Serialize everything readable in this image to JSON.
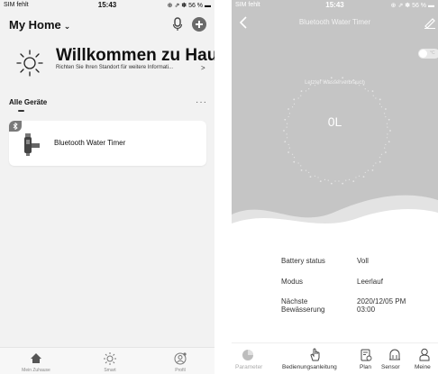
{
  "left_screen": {
    "status": {
      "carrier": "SIM fehlt",
      "time": "15:43",
      "battery": "56 %"
    },
    "home_title": "My Home",
    "welcome_title": "Willkommen zu Hau...",
    "welcome_subtitle": "Richten Sie Ihren Standort für weitere Informati...",
    "devices_label": "Alle Geräte",
    "devices": [
      {
        "name": "Bluetooth Water Timer"
      }
    ],
    "tabs": [
      {
        "label": "Mein Zuhause",
        "icon": "home-icon"
      },
      {
        "label": "Smart",
        "icon": "sun-icon"
      },
      {
        "label": "Profil",
        "icon": "profile-icon"
      }
    ]
  },
  "right_screen": {
    "status": {
      "carrier": "SIM fehlt",
      "time": "15:43",
      "battery": "56 %"
    },
    "title": "Bluetooth Water Timer",
    "unit_toggle": "°C",
    "dial_label": "Letzter Wasserverbrauch",
    "dial_value": "0L",
    "info": [
      {
        "label": "Battery status",
        "value": "Voll"
      },
      {
        "label": "Modus",
        "value": "Leerlauf"
      },
      {
        "label": "Nächste Bewässerung",
        "value": "2020/12/05 PM 03:00"
      }
    ],
    "tabs": [
      {
        "label": "Parameter",
        "icon": "chart-icon"
      },
      {
        "label": "Bedienungsanleitung",
        "icon": "hand-icon"
      },
      {
        "label": "Plan",
        "icon": "schedule-icon"
      },
      {
        "label": "Sensor",
        "icon": "sensor-icon"
      },
      {
        "label": "Meine",
        "icon": "person-icon"
      }
    ]
  },
  "colors": {
    "hero_gray": "#c5c5c5",
    "background": "#f2f2f2",
    "card": "#ffffff"
  }
}
